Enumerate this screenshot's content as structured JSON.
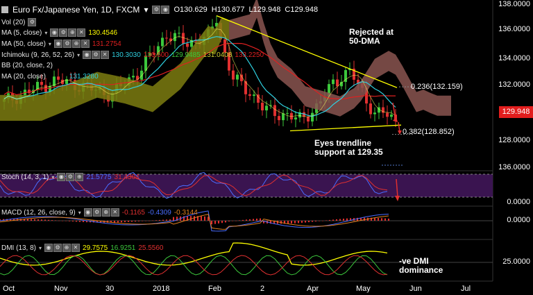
{
  "header": {
    "symbol_title": "Euro Fx/Japanese Yen, 1D, FXCM",
    "open": "O130.629",
    "high": "H130.677",
    "low": "L129.948",
    "close": "C129.948"
  },
  "indicators": {
    "vol": "Vol (20)",
    "ma5": "MA (5, close)",
    "ma5_val": "130.4546",
    "ma50": "MA (50, close)",
    "ma50_val": "131.2754",
    "ichimoku": "Ichimoku (9, 26, 52, 26)",
    "ichimoku_vals": [
      "130.3030",
      "130.600",
      "129.9485",
      "131.0408",
      "133.2250"
    ],
    "bb": "BB (20, close, 2)",
    "ma20": "MA (20, close)",
    "ma20_val": "131.3280",
    "stoch": "Stoch (14, 3, 1)",
    "stoch_vals": [
      "21.5775",
      "31.4304"
    ],
    "macd": "MACD (12, 26, close, 9)",
    "macd_vals": [
      "-0.1165",
      "-0.4309",
      "-0.3144"
    ],
    "dmi": "DMI (13, 8)",
    "dmi_vals": [
      "29.7575",
      "16.9251",
      "25.5560"
    ]
  },
  "annotations": {
    "rejected_1": "Rejected at",
    "rejected_2": "50-DMA",
    "eyes_1": "Eyes trendline",
    "eyes_2": "support at 129.35",
    "dmi_1": "-ve DMI",
    "dmi_2": "dominance",
    "fib236": "0.236(132.159)",
    "fib382": "0.382(128.852)"
  },
  "price_axis": {
    "main": [
      "138.0000",
      "136.0000",
      "134.0000",
      "132.0000",
      "128.0000"
    ],
    "last_price": "129.948",
    "stoch": [
      "136.0000",
      "0.0000"
    ],
    "macd": "0.0000",
    "dmi": "25.0000"
  },
  "x_labels": [
    "Oct",
    "Nov",
    "30",
    "2018",
    "Feb",
    "2",
    "Apr",
    "May",
    "Jun",
    "Jul"
  ],
  "colors": {
    "up": "#3cc83c",
    "down": "#e03030",
    "ma5": "#ffff00",
    "ma50": "#e02020",
    "ma20": "#2fd0e0",
    "cloud_bull": "#7d7d10",
    "cloud_bear": "#8a5550",
    "stoch_k": "#4a6dff",
    "stoch_d": "#e03030",
    "stoch_bg": "#3a1450"
  },
  "chart_data": {
    "type": "line",
    "title": "Euro Fx/Japanese Yen, 1D, FXCM",
    "xlabel": "",
    "ylabel": "",
    "ylim": [
      127,
      138
    ],
    "categories": [
      "Oct",
      "Nov",
      "30",
      "2018",
      "Feb",
      "2",
      "Apr",
      "May",
      "Jun",
      "Jul"
    ],
    "series": [
      {
        "name": "Euro Fx/Japanese Yen",
        "values": [
          131.5,
          132.5,
          132.5,
          135.5,
          135.5,
          130.5,
          130.0,
          132.8,
          129.9
        ]
      }
    ],
    "annotations": [
      "Rejected at 50-DMA",
      "Eyes trendline support at 129.35",
      "0.236(132.159)",
      "0.382(128.852)",
      "-ve DMI dominance"
    ]
  }
}
